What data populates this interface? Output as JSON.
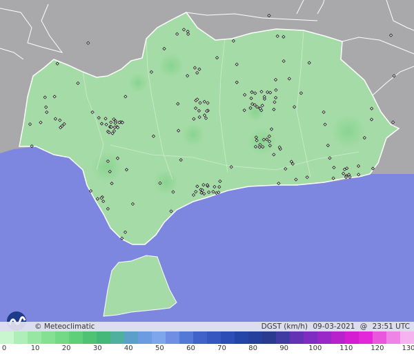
{
  "credit": "© Meteoclimatic",
  "variable": "DGST (km/h)",
  "date": "09-03-2021",
  "at": "@",
  "time": "23:51 UTC",
  "legend": {
    "ticks": [
      "0",
      "10",
      "20",
      "30",
      "40",
      "50",
      "60",
      "70",
      "80",
      "90",
      "100",
      "110",
      "120",
      "130"
    ],
    "colors": [
      "#c9f5cf",
      "#b0eeb9",
      "#98e6a4",
      "#86e094",
      "#74d986",
      "#5fcf7a",
      "#4fc274",
      "#44b878",
      "#4fb0a0",
      "#5aa0c8",
      "#6b9be0",
      "#7ea6ec",
      "#6f8ee4",
      "#5478d6",
      "#3f63c8",
      "#3557bf",
      "#2c4db5",
      "#2345a8",
      "#243f9c",
      "#2a3a8e",
      "#403ba2",
      "#6233b4",
      "#7f2cc2",
      "#9a27c8",
      "#b822cc",
      "#d41ed2",
      "#e228d8",
      "#ea56de",
      "#ef84e6",
      "#f5b4ef"
    ]
  },
  "colors": {
    "sea": "#7e87e0",
    "land_outside": "#a9a9ab",
    "region_fill": "#a5dba6",
    "border": "#ffffff",
    "station": "#222222"
  },
  "map_stations": 180
}
